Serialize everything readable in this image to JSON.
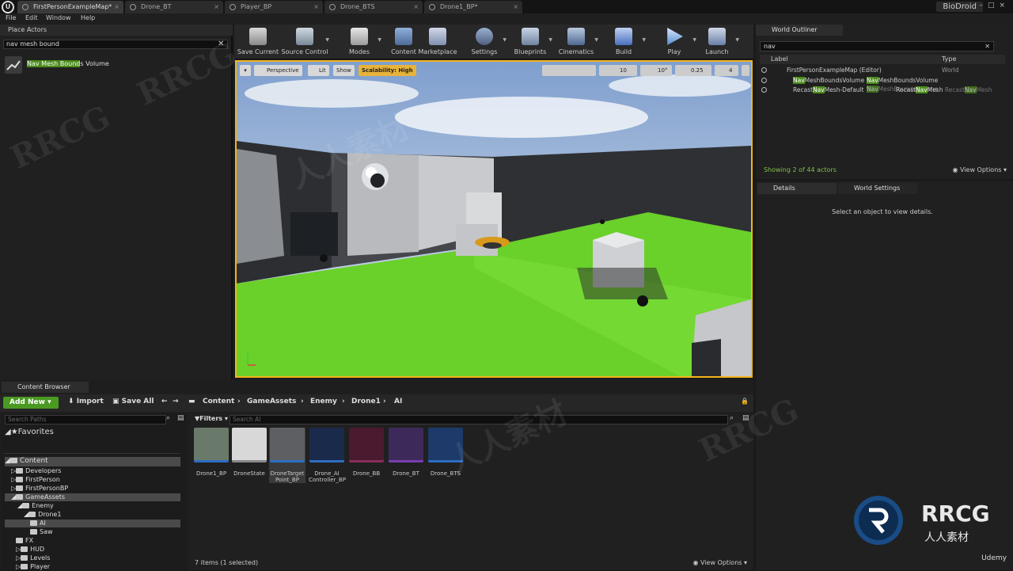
{
  "tabs": [
    {
      "label": "FirstPersonExampleMap*"
    },
    {
      "label": "Drone_BT"
    },
    {
      "label": "Player_BP"
    },
    {
      "label": "Drone_BTS"
    },
    {
      "label": "Drone1_BP*"
    }
  ],
  "project_name": "BioDroid",
  "menu": [
    "File",
    "Edit",
    "Window",
    "Help"
  ],
  "place_actors": {
    "title": "Place Actors",
    "search_value": "nav mesh bound",
    "result": {
      "match": "Nav Mesh Bound",
      "rest": "s Volume"
    }
  },
  "toolbar": {
    "items": [
      "Save Current",
      "Source Control",
      "Modes",
      "Content",
      "Marketplace",
      "Settings",
      "Blueprints",
      "Cinematics",
      "Build",
      "Play",
      "Launch"
    ]
  },
  "viewport": {
    "perspective": "Perspective",
    "lit": "Lit",
    "show": "Show",
    "scalability": "Scalability: High",
    "grid": "10",
    "rotation": "10°",
    "scale": "0.25",
    "cam_speed": "4"
  },
  "world_outliner": {
    "title": "World Outliner",
    "search_value": "nav",
    "col_label": "Label",
    "col_type": "Type",
    "rows": [
      {
        "label": "FirstPersonExampleMap (Editor)",
        "type": "World"
      },
      {
        "label_pre": "",
        "label_hl": "Nav",
        "label_post": "MeshBoundsVolume",
        "type_pre": "",
        "type_hl": "Nav",
        "type_post": "MeshBoundsVolume",
        "type_pre2": "",
        "type_hl2": "Nav",
        "type_post2": "MeshBoundsVolume"
      },
      {
        "label_pre": "Recast",
        "label_hl": "Nav",
        "label_post": "Mesh-Default",
        "type_pre": "Recast",
        "type_hl": "Nav",
        "type_post": "Mesh",
        "type_pre2": "Recast",
        "type_hl2": "Nav",
        "type_post2": "Mesh"
      }
    ],
    "status": "Showing 2 of 44 actors",
    "view_options": "View Options"
  },
  "details": {
    "tab": "Details",
    "world_settings_tab": "World Settings",
    "message": "Select an object to view details."
  },
  "content_browser": {
    "title": "Content Browser",
    "add_new": "Add New",
    "import": "Import",
    "save_all": "Save All",
    "breadcrumb": [
      "Content",
      "GameAssets",
      "Enemy",
      "Drone1",
      "AI"
    ],
    "search_paths_placeholder": "Search Paths",
    "filters": "Filters",
    "search_ai_placeholder": "Search AI",
    "favorites": "Favorites",
    "tree": [
      {
        "label": "Content",
        "level": 0,
        "selected": true
      },
      {
        "label": "Developers",
        "level": 1
      },
      {
        "label": "FirstPerson",
        "level": 1
      },
      {
        "label": "FirstPersonBP",
        "level": 1
      },
      {
        "label": "GameAssets",
        "level": 1,
        "selected": true
      },
      {
        "label": "Enemy",
        "level": 2
      },
      {
        "label": "Drone1",
        "level": 3
      },
      {
        "label": "AI",
        "level": 4,
        "selected": true
      },
      {
        "label": "Saw",
        "level": 3
      },
      {
        "label": "FX",
        "level": 1
      },
      {
        "label": "HUD",
        "level": 1
      },
      {
        "label": "Levels",
        "level": 1
      },
      {
        "label": "Player",
        "level": 1
      }
    ],
    "assets": [
      {
        "name": "Drone1_BP",
        "color": "#2d6ec2"
      },
      {
        "name": "DroneState",
        "color": "#888888"
      },
      {
        "name": "DroneTarget Point_BP",
        "color": "#2d6ec2"
      },
      {
        "name": "Drone_AI Controller_BP",
        "color": "#2d6ec2"
      },
      {
        "name": "Drone_BB",
        "color": "#8a2d5a"
      },
      {
        "name": "Drone_BT",
        "color": "#7a3db0"
      },
      {
        "name": "Drone_BTS",
        "color": "#2d6ec2"
      }
    ],
    "status": "7 items (1 selected)",
    "view_options": "View Options"
  },
  "branding": {
    "logo_text": "RRCG",
    "logo_sub": "人人素材",
    "udemy": "Udemy",
    "watermark": "RRCG",
    "watermark_cn": "人人素材"
  }
}
